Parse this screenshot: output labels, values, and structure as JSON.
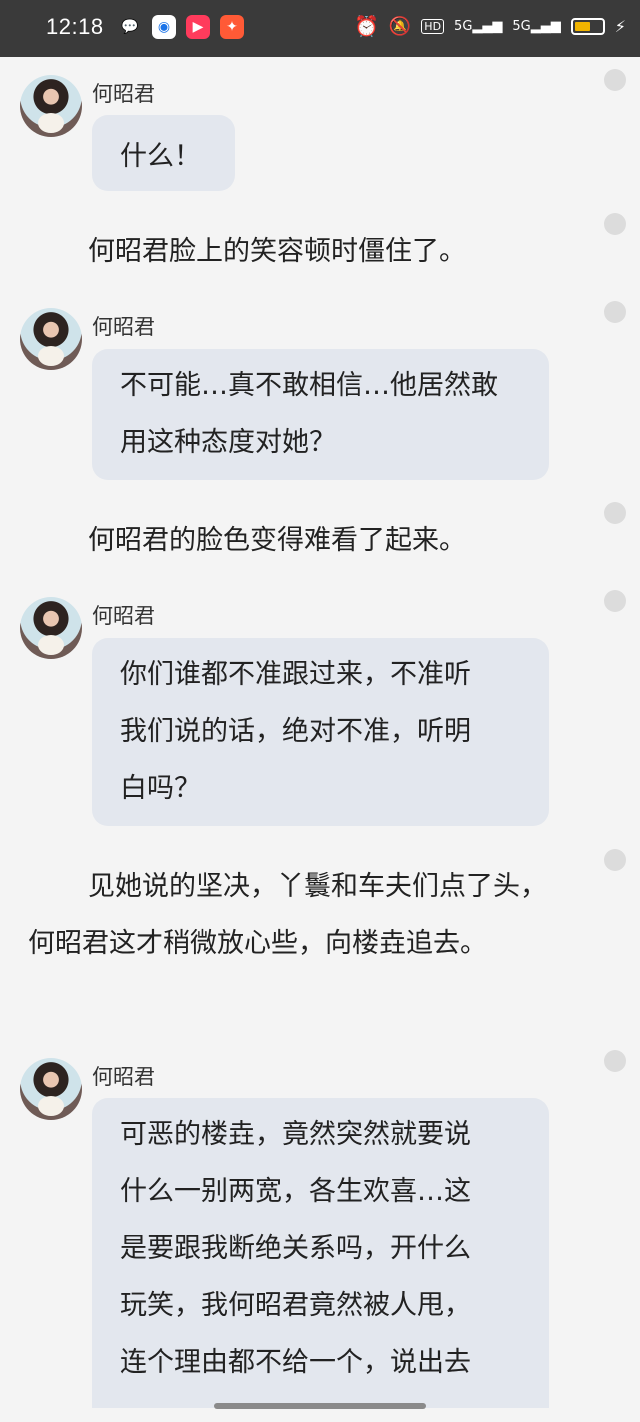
{
  "status_bar": {
    "time": "12:18",
    "left_icons": [
      "wechat-icon",
      "browser-icon",
      "video-icon",
      "game-icon"
    ],
    "right_icons": [
      "alarm-icon",
      "mute-icon",
      "hd-icon",
      "signal-5g-icon",
      "signal-5g-icon",
      "battery-icon",
      "charging-icon"
    ],
    "hd_label": "HD",
    "net1": "5G",
    "net2": "5G",
    "battery_level": 0.6
  },
  "messages": [
    {
      "type": "dialog",
      "speaker": "何昭君",
      "lines": [
        "什么！"
      ]
    },
    {
      "type": "narration",
      "text": "何昭君脸上的笑容顿时僵住了。"
    },
    {
      "type": "dialog",
      "speaker": "何昭君",
      "lines": [
        "不可能…真不敢相信…他居然敢",
        "用这种态度对她？"
      ]
    },
    {
      "type": "narration",
      "text": "何昭君的脸色变得难看了起来。"
    },
    {
      "type": "dialog",
      "speaker": "何昭君",
      "lines": [
        "你们谁都不准跟过来，不准听",
        "我们说的话，绝对不准，听明",
        "白吗？"
      ]
    },
    {
      "type": "narration",
      "text": "见她说的坚决，丫鬟和车夫们点了头，何昭君这才稍微放心些，向楼垚追去。"
    },
    {
      "type": "dialog",
      "speaker": "何昭君",
      "lines": [
        "可恶的楼垚，竟然突然就要说",
        "什么一别两宽，各生欢喜…这",
        "是要跟我断绝关系吗，开什么",
        "玩笑，我何昭君竟然被人甩，",
        "连个理由都不给一个，说出去"
      ]
    }
  ]
}
